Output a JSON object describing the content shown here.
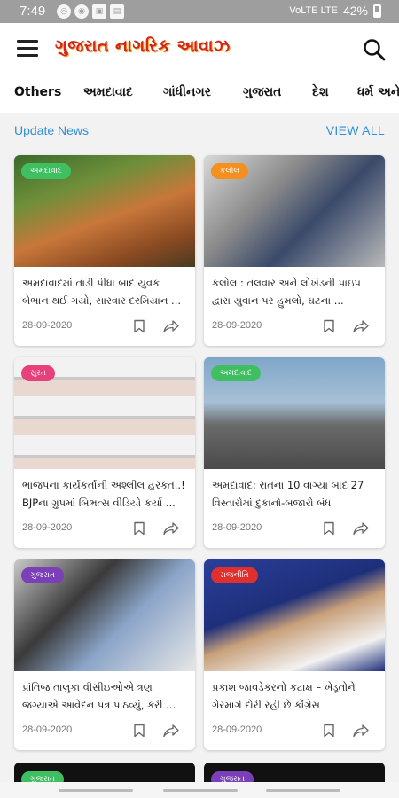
{
  "status": {
    "time": "7:49",
    "signal": "VoLTE LTE",
    "battery": "42%"
  },
  "header": {
    "logo": "ગુજરાત નાગરિક આવાઝ"
  },
  "tabs": [
    "Others",
    "અમદાવાદ",
    "ગાંધીનગર",
    "ગુજરાત",
    "દેશ",
    "ધર્મ અને"
  ],
  "section": {
    "title": "Update News",
    "view_all": "VIEW ALL"
  },
  "colors": {
    "accent": "#2f8fd8",
    "badge_green": "#3fbf62",
    "badge_orange": "#f5901e",
    "badge_pink": "#e8407a",
    "badge_purple": "#7b3fb8",
    "badge_red": "#e0302e"
  },
  "cards": [
    {
      "category": "અમદાવાદ",
      "badge_color": "#3fbf62",
      "title": "અમદાવાદમાં તાડી પીધા બાદ યુવક બેભાન થઈ ગયો, સારવાર દરમિયાન ...",
      "date": "28-09-2020"
    },
    {
      "category": "કલોલ",
      "badge_color": "#f5901e",
      "title": "કલોલ : તલવાર અને લોખંડની પાઇપ દ્વારા યુવાન પર હુમલો, ઘટના ...",
      "date": "28-09-2020"
    },
    {
      "category": "સુરત",
      "badge_color": "#e8407a",
      "title": "ભાજપના કાર્યકર્તાની અશ્લીલ હરકત..! BJPના ગ્રુપમાં બિભત્સ વીડિયો કર્યા ...",
      "date": "28-09-2020"
    },
    {
      "category": "અમદાવાદ",
      "badge_color": "#3fbf62",
      "title": "અમદાવાદ: રાતના 10 વાગ્યા બાદ 27 વિસ્તારોમાં દુકાનો-બજારો બંધ",
      "date": "28-09-2020"
    },
    {
      "category": "ગુજરાત",
      "badge_color": "#7b3fb8",
      "title": "પ્રાંતિજ તાલુકા વીસીઇઓએ ત્રણ જગ્યાએ આવેદન પત્ર પાઠવ્યું, કરી ...",
      "date": "28-09-2020"
    },
    {
      "category": "રાજનીતિ",
      "badge_color": "#e0302e",
      "title": "પ્રકાશ જાવડેકરનો કટાક્ષ – ખેડૂતોને ગેરમાર્ગે દોરી રહી છે કોંગ્રેસ",
      "date": "28-09-2020"
    }
  ],
  "partial_cards": [
    {
      "category": "ગુજરાત",
      "badge_color": "#3fbf62"
    },
    {
      "category": "ગુજરાત",
      "badge_color": "#7b3fb8"
    }
  ]
}
